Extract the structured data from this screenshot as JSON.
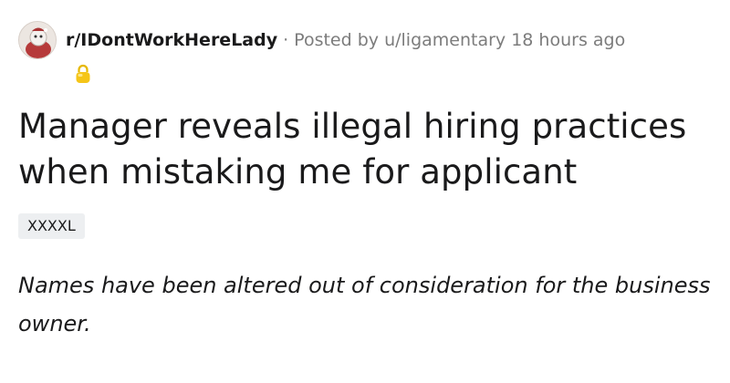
{
  "post": {
    "subreddit": "r/IDontWorkHereLady",
    "separator": "·",
    "posted_by_prefix": "Posted by",
    "author": "u/ligamentary",
    "time_ago": "18 hours ago",
    "award_icon": "gold-lock-award-icon",
    "title": "Manager reveals illegal hiring practices when mistaking me for applicant",
    "flair": "XXXXL",
    "body": "Names have been altered out of consideration for the business owner."
  },
  "colors": {
    "text": "#1a1a1b",
    "meta": "#7c7c7c",
    "flair_bg": "#edeff1",
    "award": "#f5c518"
  }
}
